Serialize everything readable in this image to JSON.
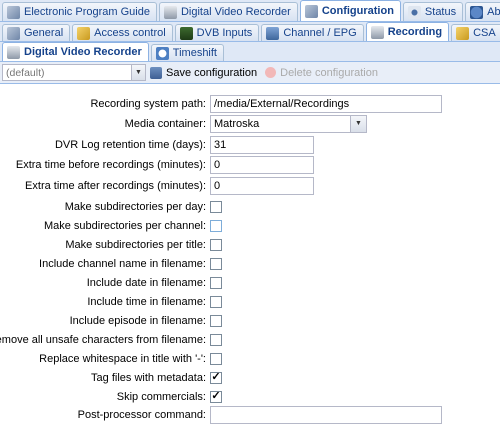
{
  "tabs_level1": [
    {
      "label": "Electronic Program Guide",
      "icon": "wrench-icon",
      "active": false
    },
    {
      "label": "Digital Video Recorder",
      "icon": "drive-icon",
      "active": false
    },
    {
      "label": "Configuration",
      "icon": "wrench-icon",
      "active": true
    },
    {
      "label": "Status",
      "icon": "eye-icon",
      "active": false
    },
    {
      "label": "About",
      "icon": "info-icon",
      "active": false
    }
  ],
  "tabs_level2": [
    {
      "label": "General",
      "icon": "wrench-icon",
      "active": false
    },
    {
      "label": "Access control",
      "icon": "key-icon",
      "active": false
    },
    {
      "label": "DVB Inputs",
      "icon": "chip-icon",
      "active": false
    },
    {
      "label": "Channel / EPG",
      "icon": "tv-icon",
      "active": false
    },
    {
      "label": "Recording",
      "icon": "drive-icon",
      "active": true
    },
    {
      "label": "CSA",
      "icon": "key-icon",
      "active": false
    }
  ],
  "tabs_level3": [
    {
      "label": "Digital Video Recorder",
      "icon": "drive-icon",
      "active": true
    },
    {
      "label": "Timeshift",
      "icon": "clock-icon",
      "active": false
    }
  ],
  "toolbar": {
    "config_select": "(default)",
    "save_label": "Save configuration",
    "delete_label": "Delete configuration"
  },
  "form": {
    "recording_path_label": "Recording system path:",
    "recording_path_value": "/media/External/Recordings",
    "media_container_label": "Media container:",
    "media_container_value": "Matroska",
    "retention_label": "DVR Log retention time (days):",
    "retention_value": "31",
    "extra_before_label": "Extra time before recordings (minutes):",
    "extra_before_value": "0",
    "extra_after_label": "Extra time after recordings (minutes):",
    "extra_after_value": "0",
    "checkboxes": [
      {
        "label": "Make subdirectories per day:",
        "checked": false
      },
      {
        "label": "Make subdirectories per channel:",
        "checked": false
      },
      {
        "label": "Make subdirectories per title:",
        "checked": false
      },
      {
        "label": "Include channel name in filename:",
        "checked": false
      },
      {
        "label": "Include date in filename:",
        "checked": false
      },
      {
        "label": "Include time in filename:",
        "checked": false
      },
      {
        "label": "Include episode in filename:",
        "checked": false
      },
      {
        "label": "Remove all unsafe characters from filename:",
        "checked": false
      },
      {
        "label": "Replace whitespace in title with '-':",
        "checked": false
      },
      {
        "label": "Tag files with metadata:",
        "checked": true
      },
      {
        "label": "Skip commercials:",
        "checked": true
      }
    ],
    "postprocessor_label": "Post-processor command:",
    "postprocessor_value": ""
  },
  "colors": {
    "tab_text": "#15428b",
    "tab_border": "#99bbe8",
    "panel_bg": "#dfe8f6"
  }
}
